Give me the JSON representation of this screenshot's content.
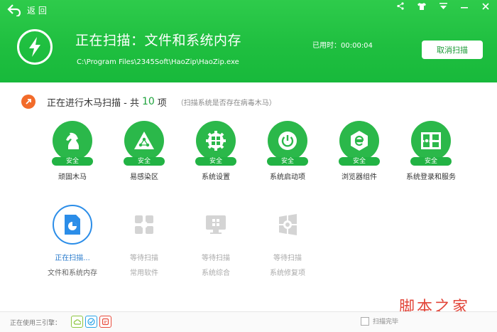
{
  "header": {
    "back_label": "返 回",
    "title": "正在扫描：文件和系统内存",
    "path": "C:\\Program Files\\2345Soft\\HaoZip\\HaoZip.exe",
    "elapsed": "已用时：00:00:04",
    "cancel_label": "取消扫描"
  },
  "status": {
    "prefix": "正在进行木马扫描 - 共",
    "count": "10",
    "suffix": "项",
    "hint": "（扫描系统是否存在病毒木马）"
  },
  "done_items": [
    {
      "label": "顽固木马",
      "badge": "安全",
      "icon": "horse-icon"
    },
    {
      "label": "易感染区",
      "badge": "安全",
      "icon": "biohazard-icon"
    },
    {
      "label": "系统设置",
      "badge": "安全",
      "icon": "windows-gear-icon"
    },
    {
      "label": "系统启动项",
      "badge": "安全",
      "icon": "power-icon"
    },
    {
      "label": "浏览器组件",
      "badge": "安全",
      "icon": "ie-browser-icon"
    },
    {
      "label": "系统登录和服务",
      "badge": "安全",
      "icon": "login-service-icon"
    }
  ],
  "active_item": {
    "state": "正在扫描...",
    "label": "文件和系统内存",
    "icon": "memory-file-icon"
  },
  "pending_items": [
    {
      "state": "等待扫描",
      "label": "常用软件",
      "icon": "software-icon"
    },
    {
      "state": "等待扫描",
      "label": "系统综合",
      "icon": "system-monitor-icon"
    },
    {
      "state": "等待扫描",
      "label": "系统修复项",
      "icon": "system-repair-icon"
    }
  ],
  "footer": {
    "engines_label": "正在使用三引擎：",
    "engines": [
      {
        "icon": "cloud-engine-icon",
        "color": "#8cc63f"
      },
      {
        "icon": "check-engine-icon",
        "color": "#2aa3e8"
      },
      {
        "icon": "local-engine-icon",
        "color": "#e84b3c"
      }
    ],
    "autoclose_label": "扫描完毕"
  },
  "watermark": {
    "text": "脚本之家",
    "url": "www.jb51.net"
  },
  "colors": {
    "header_green": "#1fbf40",
    "safe_green": "#22b344",
    "active_blue": "#2b8de8",
    "orange": "#f26b2a"
  }
}
